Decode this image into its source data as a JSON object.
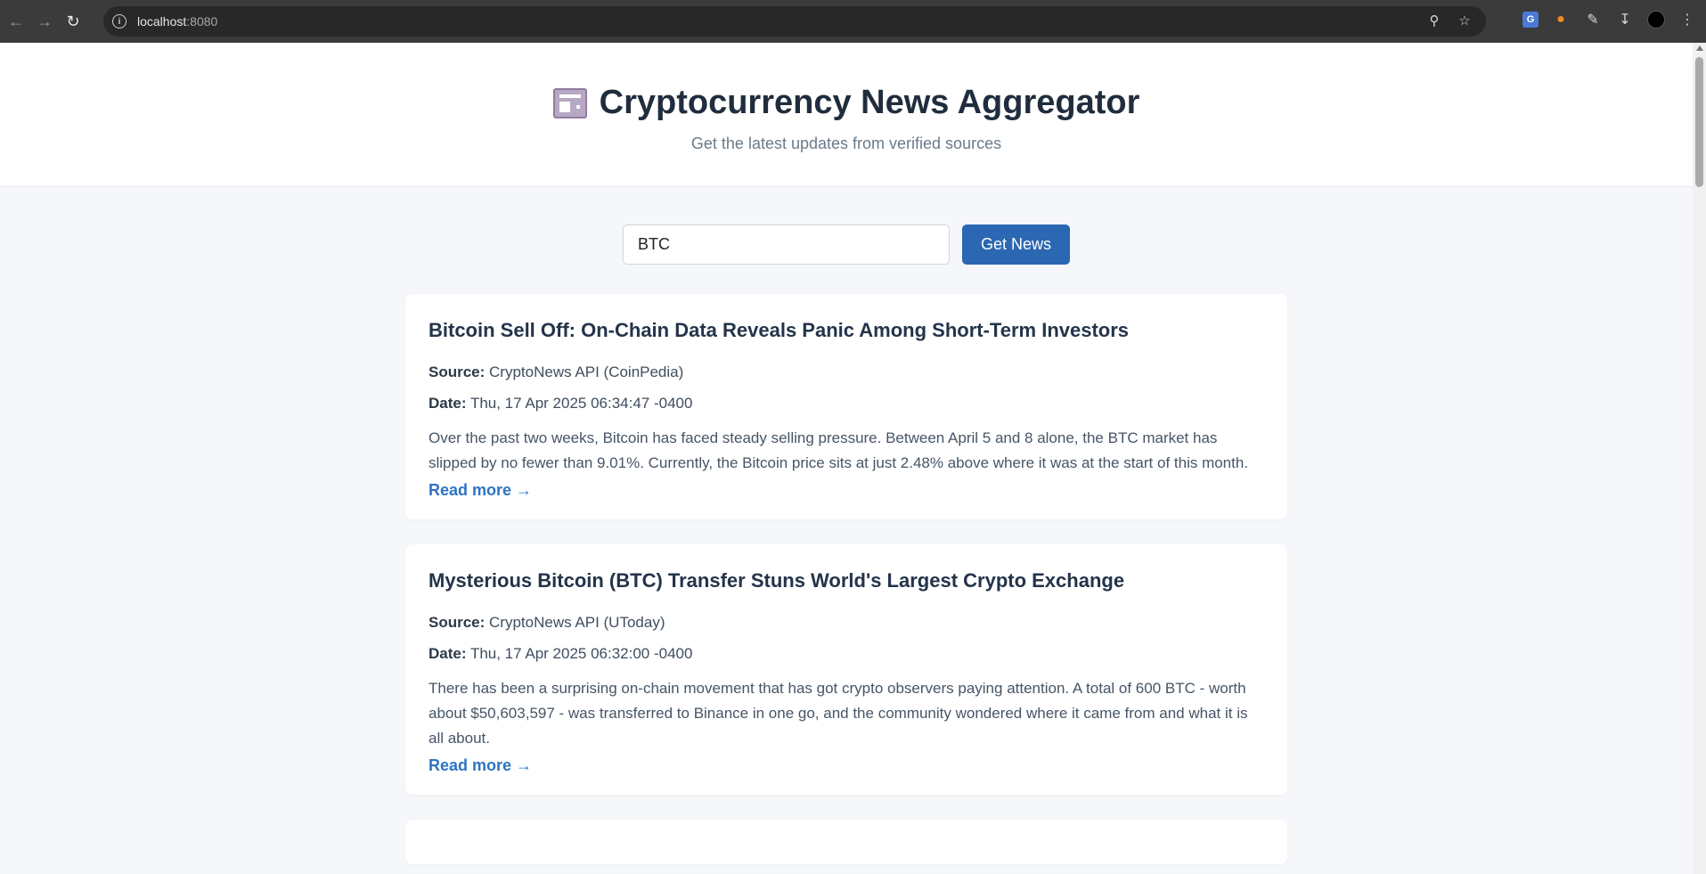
{
  "browser": {
    "url_host": "localhost",
    "url_port": ":8080",
    "nav_icons": [
      "back-arrow",
      "forward-arrow",
      "reload"
    ],
    "omnibox_icons": [
      "zoom-icon",
      "star-icon"
    ],
    "extension_icons": [
      "translate-icon",
      "fox-extension-icon",
      "puzzle-icon",
      "download-icon",
      "profile-avatar",
      "menu-icon"
    ]
  },
  "header": {
    "title": "Cryptocurrency News Aggregator",
    "subtitle": "Get the latest updates from verified sources"
  },
  "search": {
    "value": "BTC",
    "button_label": "Get News"
  },
  "articles": [
    {
      "title": "Bitcoin Sell Off: On-Chain Data Reveals Panic Among Short-Term Investors",
      "source_label": "Source:",
      "source": "CryptoNews API (CoinPedia)",
      "date_label": "Date:",
      "date": "Thu, 17 Apr 2025 06:34:47 -0400",
      "description": "Over the past two weeks, Bitcoin has faced steady selling pressure. Between April 5 and 8 alone, the BTC market has slipped by no fewer than 9.01%. Currently, the Bitcoin price sits at just 2.48% above where it was at the start of this month.",
      "read_more": "Read more →"
    },
    {
      "title": "Mysterious Bitcoin (BTC) Transfer Stuns World's Largest Crypto Exchange",
      "source_label": "Source:",
      "source": "CryptoNews API (UToday)",
      "date_label": "Date:",
      "date": "Thu, 17 Apr 2025 06:32:00 -0400",
      "description": "There has been a surprising on-chain movement that has got crypto observers paying attention. A total of 600 BTC - worth about $50,603,597 - was transferred to Binance in one go, and the community wondered where it came from and what it is all about.",
      "read_more": "Read more →"
    }
  ]
}
